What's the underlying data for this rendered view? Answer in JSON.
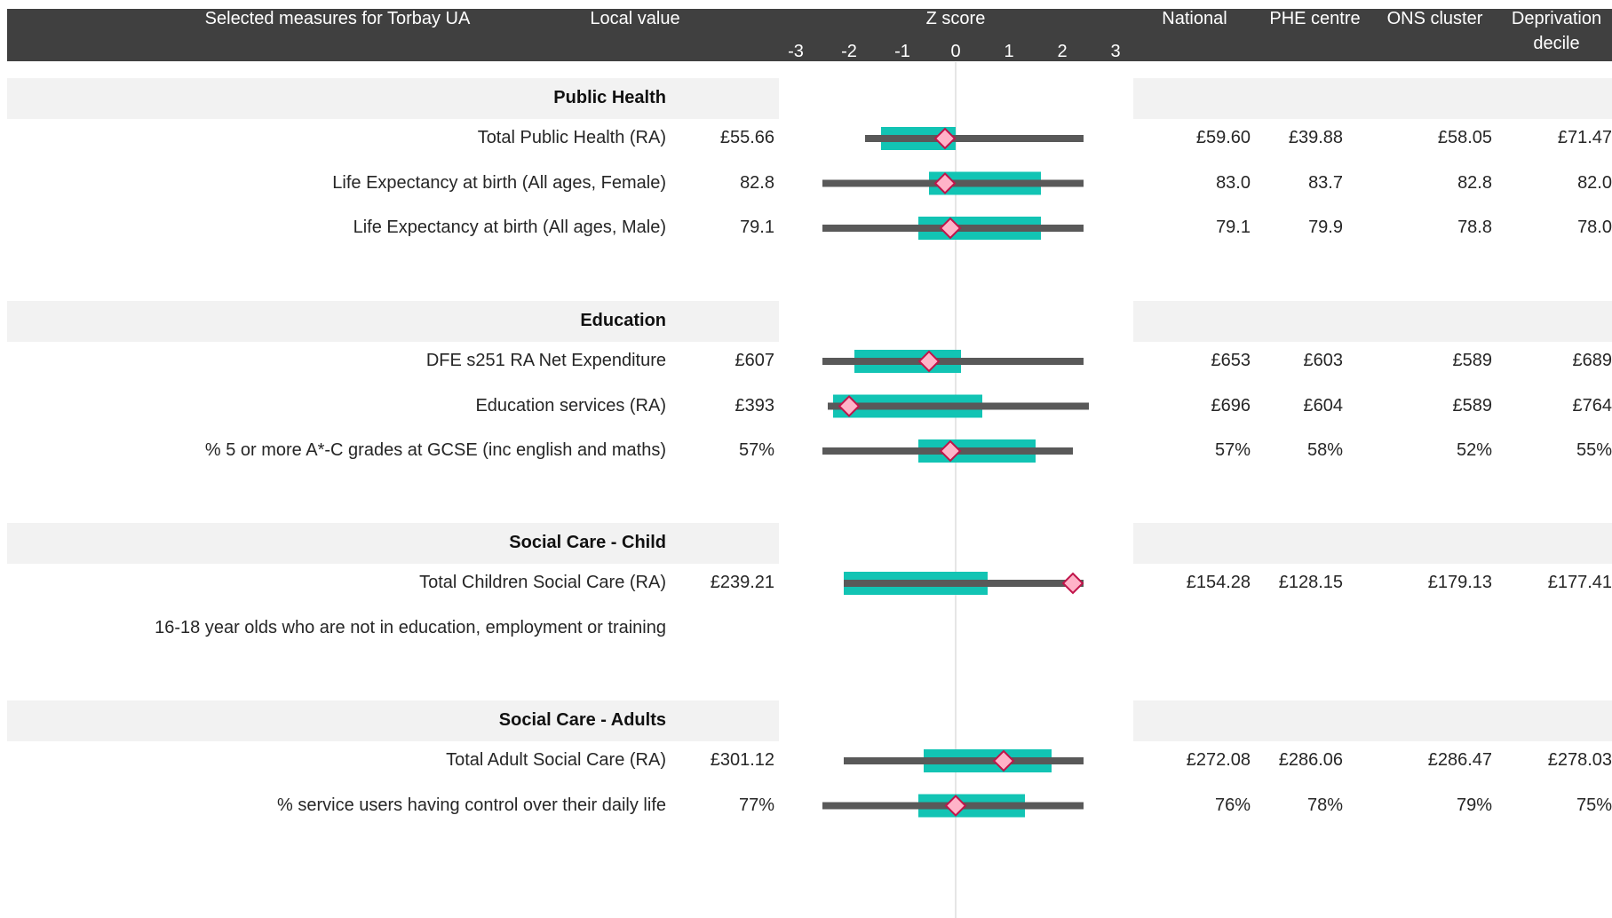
{
  "colors": {
    "header_bg": "#404040",
    "section_band": "#f2f2f2",
    "range_bar": "#595959",
    "iqr_box": "#12c4b4",
    "marker_fill": "#ffb3c8",
    "marker_stroke": "#c0144a",
    "zero_line": "#e6e6e6"
  },
  "header": {
    "measures_title": "Selected measures for Torbay UA",
    "local_value": "Local value",
    "z_score": "Z score",
    "national": "National",
    "phe_centre": "PHE centre",
    "ons_cluster": "ONS cluster",
    "deprivation_line1": "Deprivation",
    "deprivation_line2": "decile"
  },
  "chart_data": {
    "type": "box-range z-score",
    "x_ticks": [
      "-3",
      "-2",
      "-1",
      "0",
      "1",
      "2",
      "3"
    ],
    "xlim": [
      -3,
      3
    ],
    "sections": [
      {
        "name": "Public Health",
        "rows": [
          {
            "measure": "Total Public Health (RA)",
            "local": "£55.66",
            "national": "£59.60",
            "phe_centre": "£39.88",
            "ons_cluster": "£58.05",
            "deprivation": "£71.47",
            "range": [
              -1.7,
              2.4
            ],
            "box": [
              -1.4,
              0.0
            ],
            "z": -0.2
          },
          {
            "measure": "Life Expectancy at birth (All ages, Female)",
            "local": "82.8",
            "national": "83.0",
            "phe_centre": "83.7",
            "ons_cluster": "82.8",
            "deprivation": "82.0",
            "range": [
              -2.5,
              2.4
            ],
            "box": [
              -0.5,
              1.6
            ],
            "z": -0.2
          },
          {
            "measure": "Life Expectancy at birth (All ages, Male)",
            "local": "79.1",
            "national": "79.1",
            "phe_centre": "79.9",
            "ons_cluster": "78.8",
            "deprivation": "78.0",
            "range": [
              -2.5,
              2.4
            ],
            "box": [
              -0.7,
              1.6
            ],
            "z": -0.1
          }
        ]
      },
      {
        "name": "Education",
        "rows": [
          {
            "measure": "DFE s251 RA Net Expenditure",
            "local": "£607",
            "national": "£653",
            "phe_centre": "£603",
            "ons_cluster": "£589",
            "deprivation": "£689",
            "range": [
              -2.5,
              2.4
            ],
            "box": [
              -1.9,
              0.1
            ],
            "z": -0.5
          },
          {
            "measure": "Education services (RA)",
            "local": "£393",
            "national": "£696",
            "phe_centre": "£604",
            "ons_cluster": "£589",
            "deprivation": "£764",
            "range": [
              -2.4,
              2.5
            ],
            "box": [
              -2.3,
              0.5
            ],
            "z": -2.0
          },
          {
            "measure": "% 5 or more A*-C grades at GCSE (inc english and maths)",
            "local": "57%",
            "national": "57%",
            "phe_centre": "58%",
            "ons_cluster": "52%",
            "deprivation": "55%",
            "range": [
              -2.5,
              2.2
            ],
            "box": [
              -0.7,
              1.5
            ],
            "z": -0.1
          }
        ]
      },
      {
        "name": "Social Care - Child",
        "rows": [
          {
            "measure": "Total Children Social Care (RA)",
            "local": "£239.21",
            "national": "£154.28",
            "phe_centre": "£128.15",
            "ons_cluster": "£179.13",
            "deprivation": "£177.41",
            "range": [
              -2.1,
              2.4
            ],
            "box": [
              -2.1,
              0.6
            ],
            "z": 2.2
          },
          {
            "measure": "16-18 year olds who are not in education, employment or training",
            "local": "",
            "national": "",
            "phe_centre": "",
            "ons_cluster": "",
            "deprivation": "",
            "range": null,
            "box": null,
            "z": null
          }
        ]
      },
      {
        "name": "Social Care - Adults",
        "rows": [
          {
            "measure": "Total Adult Social Care (RA)",
            "local": "£301.12",
            "national": "£272.08",
            "phe_centre": "£286.06",
            "ons_cluster": "£286.47",
            "deprivation": "£278.03",
            "range": [
              -2.1,
              2.4
            ],
            "box": [
              -0.6,
              1.8
            ],
            "z": 0.9
          },
          {
            "measure": "% service users having control over their daily life",
            "local": "77%",
            "national": "76%",
            "phe_centre": "78%",
            "ons_cluster": "79%",
            "deprivation": "75%",
            "range": [
              -2.5,
              2.4
            ],
            "box": [
              -0.7,
              1.3
            ],
            "z": 0.0
          }
        ]
      }
    ]
  }
}
